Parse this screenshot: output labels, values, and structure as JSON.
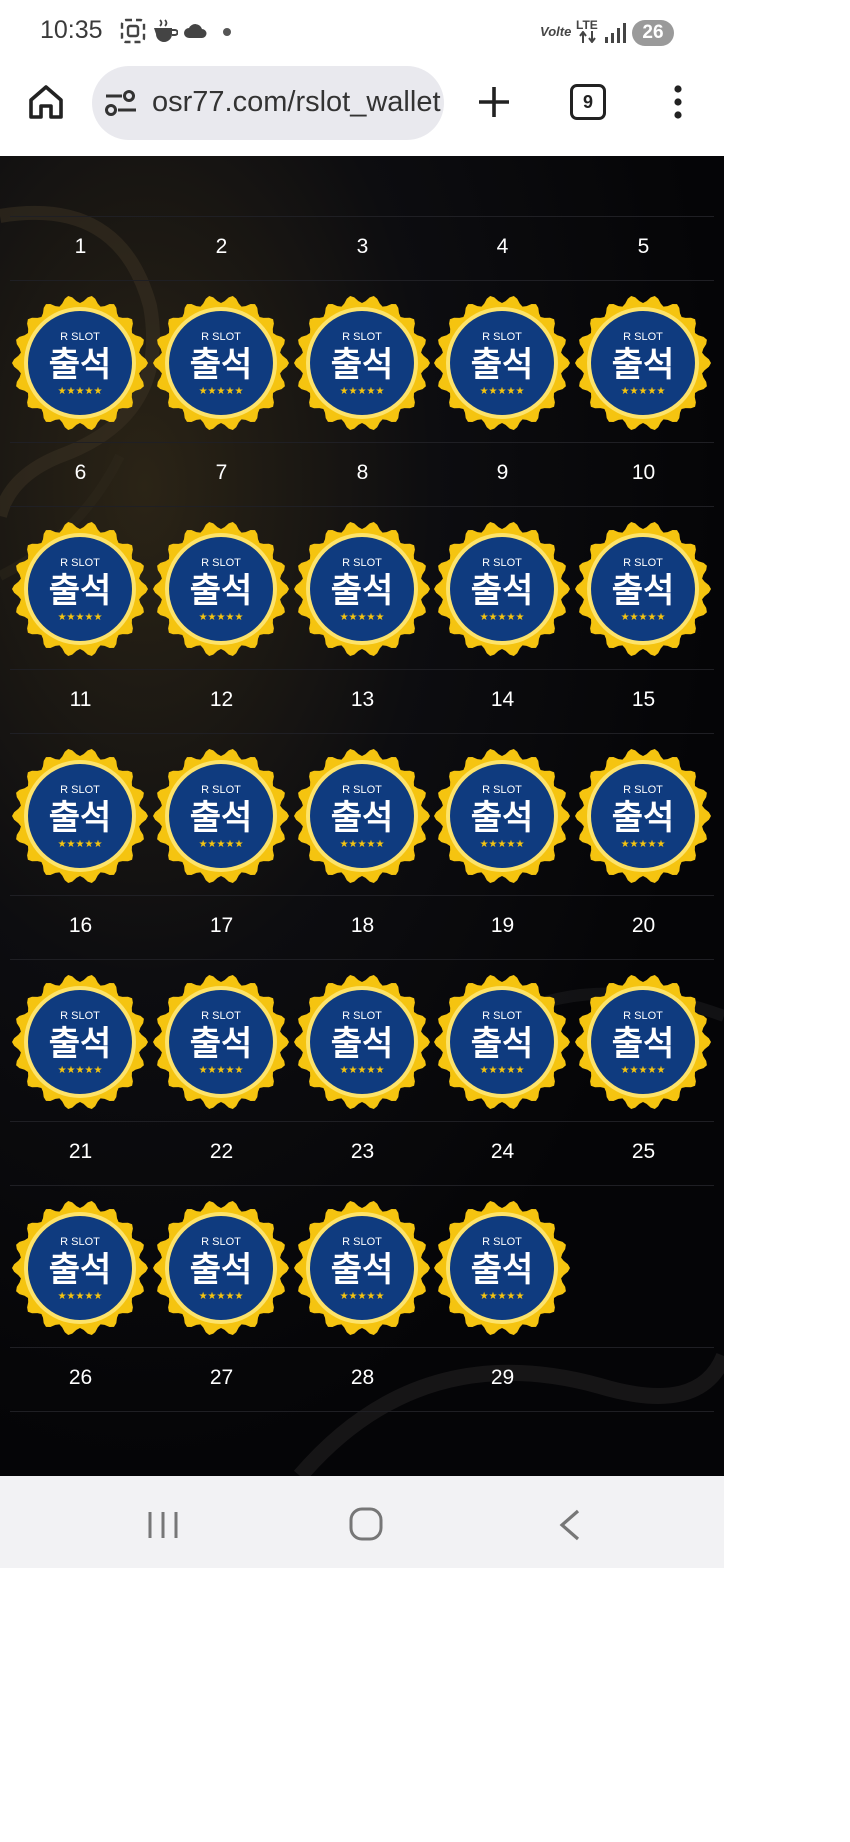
{
  "status_bar": {
    "time": "10:35",
    "network": "LTE",
    "volte": "Volte",
    "battery": "26"
  },
  "browser": {
    "url": "osr77.com/rslot_wallet",
    "tab_count": "9"
  },
  "calendar": {
    "badge": {
      "brand": "R SLOT",
      "label": "출석",
      "stars": "★★★★★"
    },
    "days": [
      {
        "day": "1",
        "checked": true
      },
      {
        "day": "2",
        "checked": true
      },
      {
        "day": "3",
        "checked": true
      },
      {
        "day": "4",
        "checked": true
      },
      {
        "day": "5",
        "checked": true
      },
      {
        "day": "6",
        "checked": true
      },
      {
        "day": "7",
        "checked": true
      },
      {
        "day": "8",
        "checked": true
      },
      {
        "day": "9",
        "checked": true
      },
      {
        "day": "10",
        "checked": true
      },
      {
        "day": "11",
        "checked": true
      },
      {
        "day": "12",
        "checked": true
      },
      {
        "day": "13",
        "checked": true
      },
      {
        "day": "14",
        "checked": true
      },
      {
        "day": "15",
        "checked": true
      },
      {
        "day": "16",
        "checked": true
      },
      {
        "day": "17",
        "checked": true
      },
      {
        "day": "18",
        "checked": true
      },
      {
        "day": "19",
        "checked": true
      },
      {
        "day": "20",
        "checked": true
      },
      {
        "day": "21",
        "checked": true
      },
      {
        "day": "22",
        "checked": true
      },
      {
        "day": "23",
        "checked": true
      },
      {
        "day": "24",
        "checked": true
      },
      {
        "day": "25",
        "checked": false
      },
      {
        "day": "26",
        "checked": false
      },
      {
        "day": "27",
        "checked": false
      },
      {
        "day": "28",
        "checked": false
      },
      {
        "day": "29",
        "checked": false
      }
    ]
  },
  "colors": {
    "badge_gold": "#f5c410",
    "badge_navy": "#0f3b7f",
    "chat_purple": "#7c64ee"
  }
}
